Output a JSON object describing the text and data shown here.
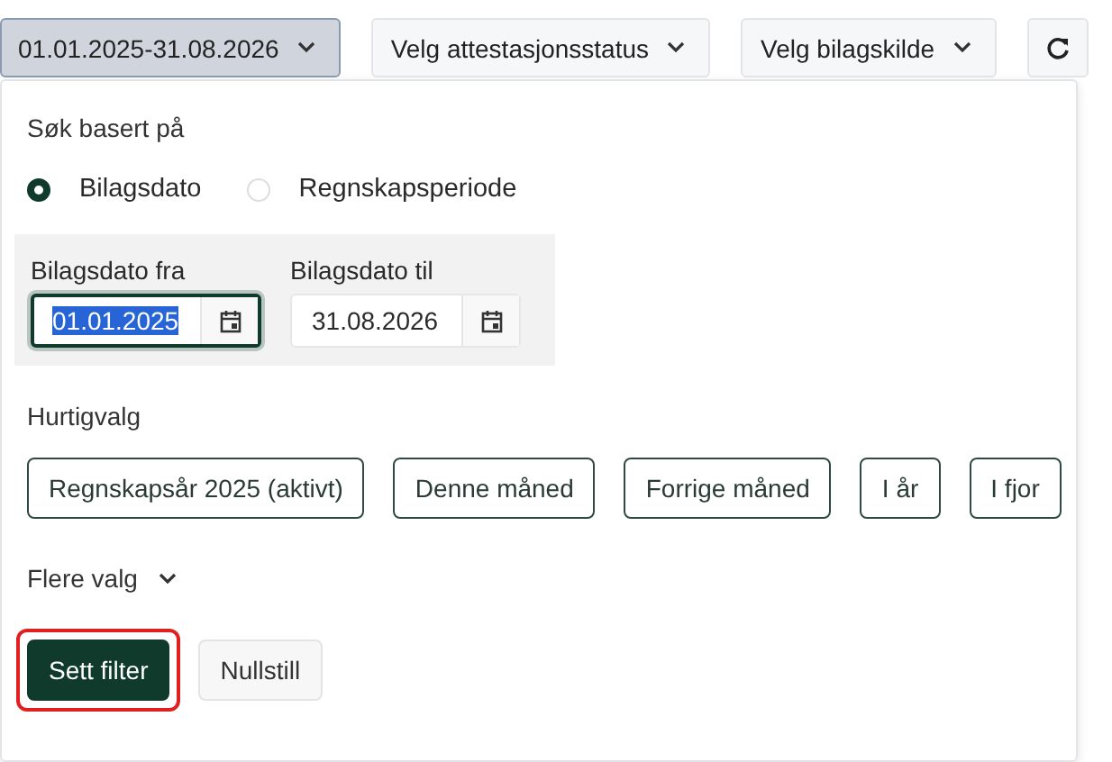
{
  "toolbar": {
    "dropdowns": [
      {
        "label": "01.01.2025-31.08.2026",
        "open": true
      },
      {
        "label": "Velg attestasjonsstatus",
        "open": false
      },
      {
        "label": "Velg bilagskilde",
        "open": false
      }
    ]
  },
  "panel": {
    "search_label": "Søk basert på",
    "radios": [
      {
        "label": "Bilagsdato",
        "selected": true
      },
      {
        "label": "Regnskapsperiode",
        "selected": false
      }
    ],
    "date_fields": [
      {
        "label": "Bilagsdato fra",
        "value": "01.01.2025",
        "focused": true
      },
      {
        "label": "Bilagsdato til",
        "value": "31.08.2026",
        "focused": false
      }
    ],
    "quick_label": "Hurtigvalg",
    "quick_options": [
      "Regnskapsår 2025 (aktivt)",
      "Denne måned",
      "Forrige måned",
      "I år",
      "I fjor"
    ],
    "more_label": "Flere valg",
    "actions": [
      {
        "label": "Sett filter",
        "kind": "primary",
        "highlighted": true
      },
      {
        "label": "Nullstill",
        "kind": "secondary",
        "highlighted": false
      }
    ]
  }
}
